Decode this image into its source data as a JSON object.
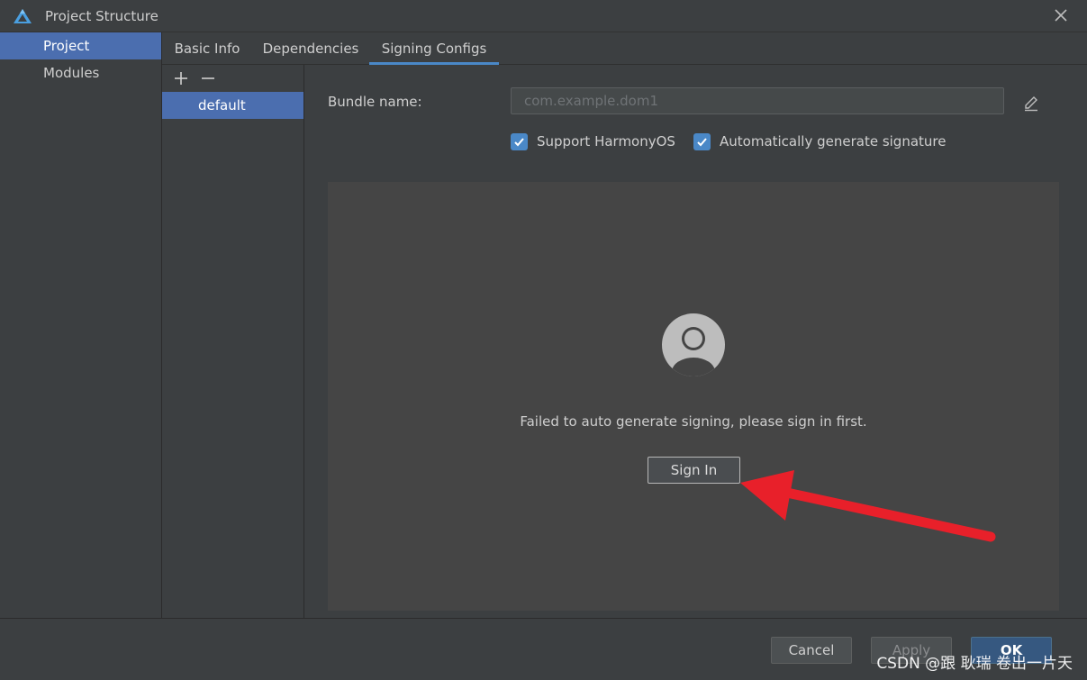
{
  "window": {
    "title": "Project Structure"
  },
  "left_nav": {
    "items": [
      {
        "label": "Project",
        "selected": true
      },
      {
        "label": "Modules",
        "selected": false
      }
    ]
  },
  "tabs": [
    {
      "label": "Basic Info",
      "active": false
    },
    {
      "label": "Dependencies",
      "active": false
    },
    {
      "label": "Signing Configs",
      "active": true
    }
  ],
  "config_list": {
    "items": [
      "default"
    ]
  },
  "signing": {
    "bundle_label": "Bundle name:",
    "bundle_placeholder": "com.example.dom1",
    "support_harmonyos_label": "Support HarmonyOS",
    "support_harmonyos_checked": true,
    "auto_sign_label": "Automatically generate signature",
    "auto_sign_checked": true,
    "fail_message": "Failed to auto generate signing, please sign in first.",
    "signin_label": "Sign In"
  },
  "buttons": {
    "cancel": "Cancel",
    "apply": "Apply",
    "ok": "OK"
  },
  "watermark": "CSDN @跟 耿瑞 卷出一片天",
  "colors": {
    "accent": "#4a88c7",
    "selection": "#4b6eaf",
    "arrow": "#e8202a"
  }
}
